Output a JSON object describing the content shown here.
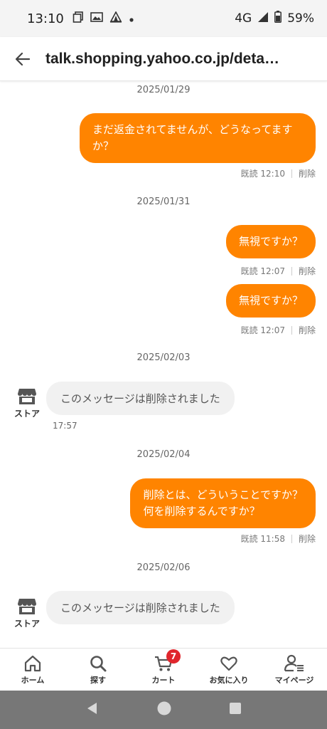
{
  "status_bar": {
    "time": "13:10",
    "network": "4G",
    "battery": "59%"
  },
  "browser": {
    "url": "talk.shopping.yahoo.co.jp/detail…"
  },
  "chat": {
    "date_1": "2025/01/29",
    "msg_1": "まだ返金されてませんが、どうなってますか？",
    "meta_1_time": "既読 12:10",
    "date_2": "2025/01/31",
    "msg_2": "無視ですか？",
    "meta_2_time": "既読 12:07",
    "msg_3": "無視ですか？",
    "meta_3_time": "既読 12:07",
    "date_3": "2025/02/03",
    "store_label": "ストア",
    "store_msg_1": "このメッセージは削除されました",
    "store_time_1": "17:57",
    "date_4": "2025/02/04",
    "msg_4_line1": "削除とは、どういうことですか？",
    "msg_4_line2": "何を削除するんですか？",
    "meta_4_time": "既読 11:58",
    "date_5": "2025/02/06",
    "store_msg_2": "このメッセージは削除されました",
    "delete_label": "削除"
  },
  "tabs": {
    "home": "ホーム",
    "search": "探す",
    "cart": "カート",
    "cart_count": "7",
    "favorites": "お気に入り",
    "mypage": "マイページ"
  },
  "colors": {
    "accent": "#ff8400",
    "badge": "#e0262d",
    "incoming": "#f1f1f1"
  }
}
